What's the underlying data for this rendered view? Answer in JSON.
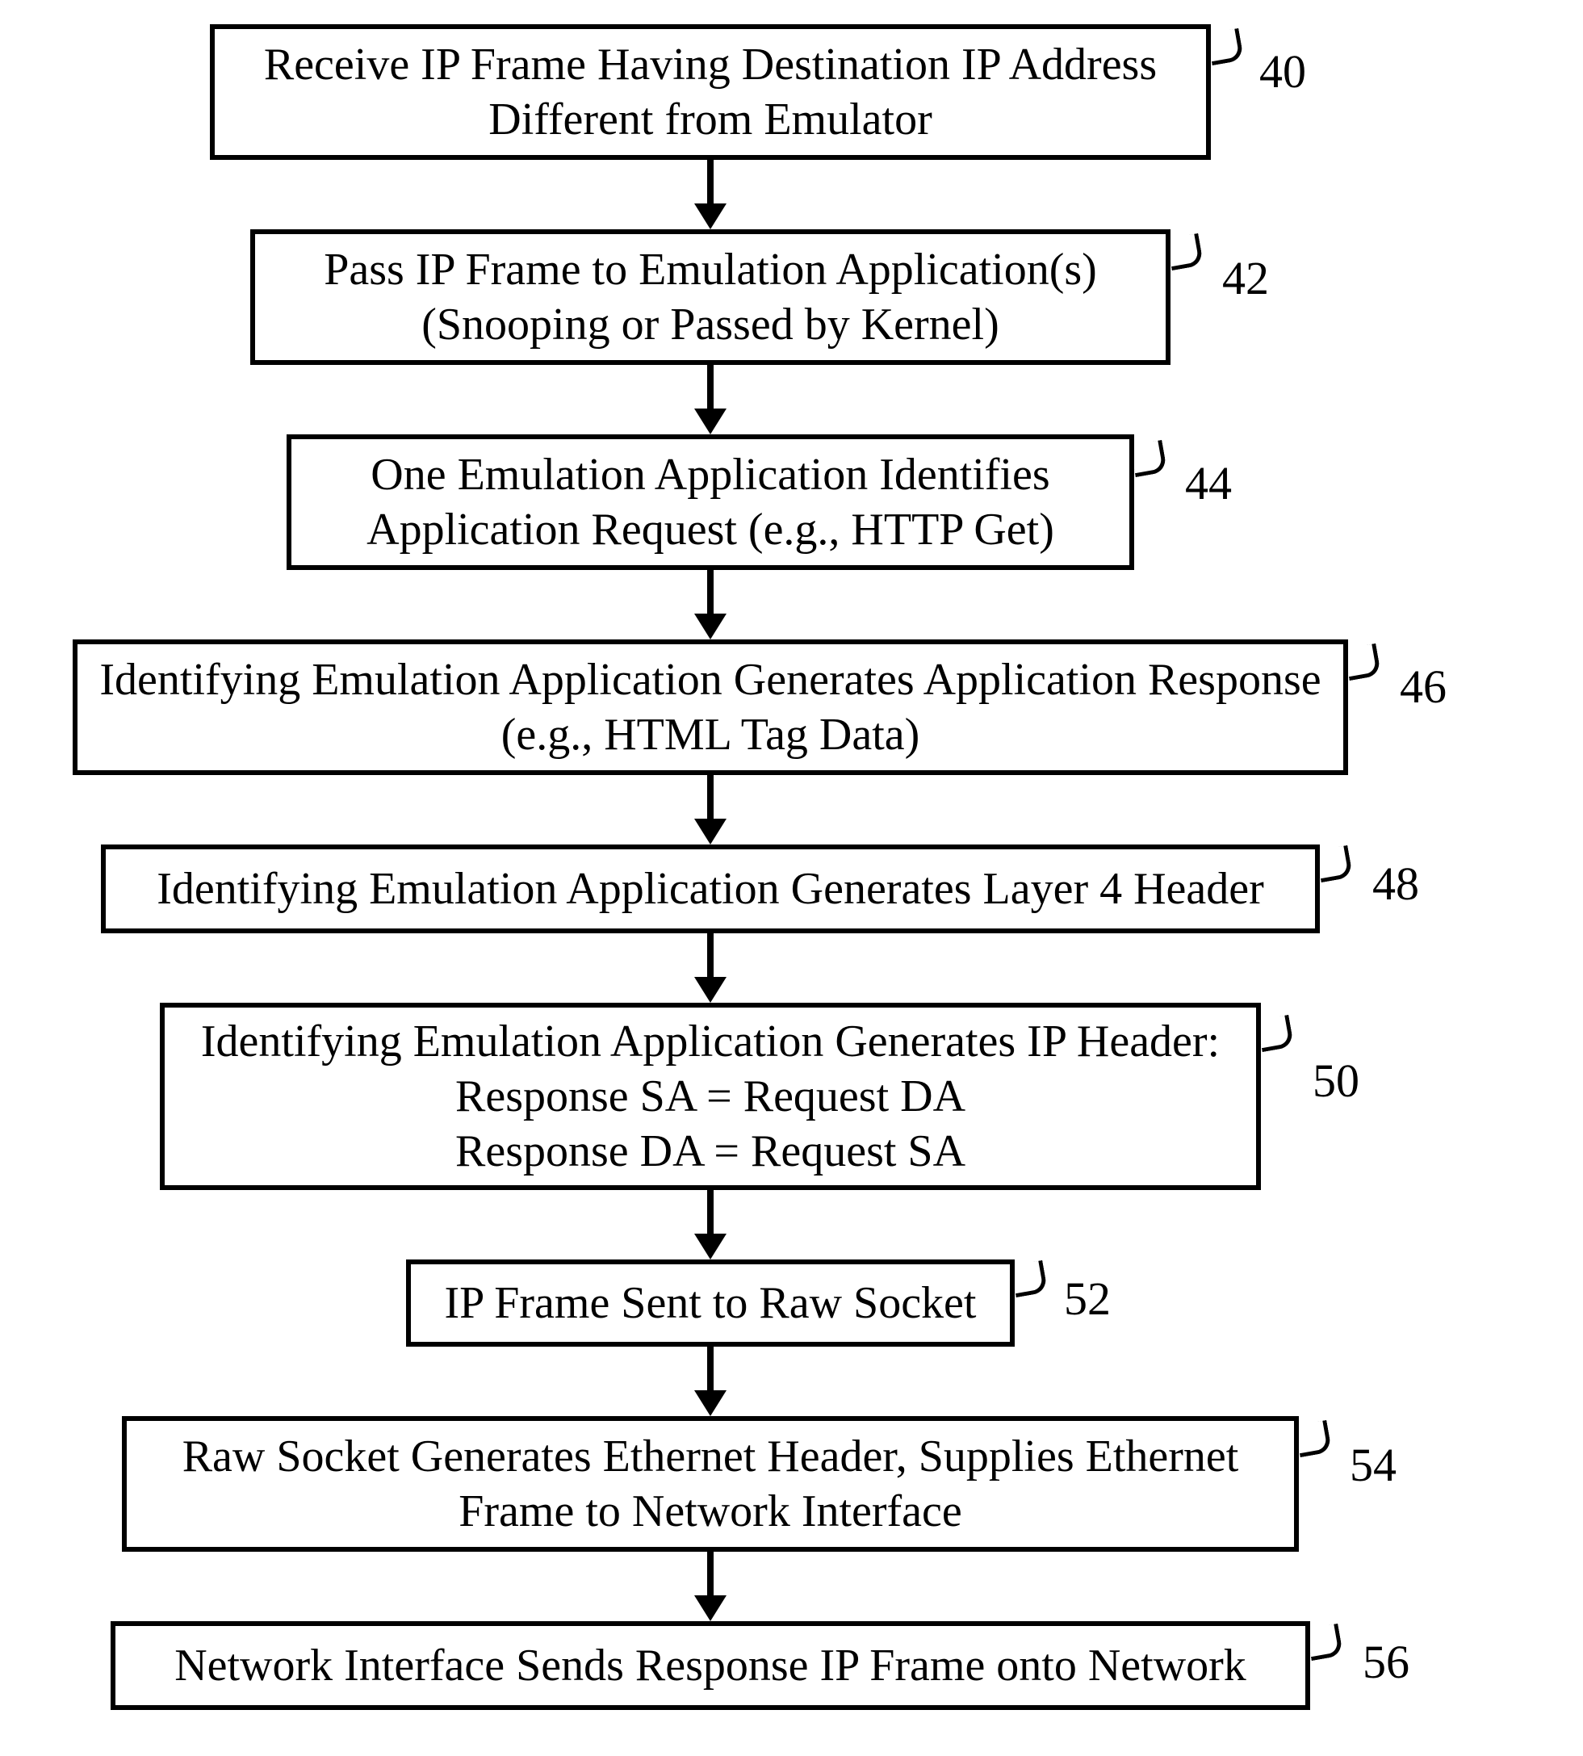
{
  "chart_data": {
    "type": "flowchart",
    "direction": "top-to-bottom",
    "nodes": [
      {
        "id": "40",
        "label": "Receive IP Frame Having Destination IP Address Different from Emulator"
      },
      {
        "id": "42",
        "label": "Pass IP Frame to Emulation Application(s) (Snooping or Passed by Kernel)"
      },
      {
        "id": "44",
        "label": "One Emulation Application Identifies Application Request (e.g., HTTP Get)"
      },
      {
        "id": "46",
        "label": "Identifying Emulation Application Generates Application Response (e.g., HTML Tag Data)"
      },
      {
        "id": "48",
        "label": "Identifying Emulation Application Generates Layer 4 Header"
      },
      {
        "id": "50",
        "label": "Identifying Emulation Application Generates IP Header:\nResponse SA = Request DA\nResponse DA = Request SA"
      },
      {
        "id": "52",
        "label": "IP Frame Sent to Raw Socket"
      },
      {
        "id": "54",
        "label": "Raw Socket Generates Ethernet Header, Supplies Ethernet Frame to Network Interface"
      },
      {
        "id": "56",
        "label": "Network Interface Sends Response IP Frame onto Network"
      }
    ],
    "edges": [
      {
        "from": "40",
        "to": "42"
      },
      {
        "from": "42",
        "to": "44"
      },
      {
        "from": "44",
        "to": "46"
      },
      {
        "from": "46",
        "to": "48"
      },
      {
        "from": "48",
        "to": "50"
      },
      {
        "from": "50",
        "to": "52"
      },
      {
        "from": "52",
        "to": "54"
      },
      {
        "from": "54",
        "to": "56"
      }
    ]
  },
  "steps": {
    "s40": {
      "num": "40",
      "text": "Receive IP Frame Having Destination IP Address\nDifferent from Emulator"
    },
    "s42": {
      "num": "42",
      "text": "Pass IP Frame to Emulation Application(s)\n(Snooping or Passed by Kernel)"
    },
    "s44": {
      "num": "44",
      "text": "One Emulation Application Identifies\nApplication Request (e.g., HTTP Get)"
    },
    "s46": {
      "num": "46",
      "text": "Identifying Emulation Application Generates Application Response\n(e.g., HTML Tag Data)"
    },
    "s48": {
      "num": "48",
      "text": "Identifying Emulation Application Generates Layer 4 Header"
    },
    "s50": {
      "num": "50",
      "text": "Identifying Emulation Application Generates IP Header:\nResponse SA = Request DA\nResponse DA = Request SA"
    },
    "s52": {
      "num": "52",
      "text": "IP Frame Sent to Raw Socket"
    },
    "s54": {
      "num": "54",
      "text": "Raw Socket Generates Ethernet Header, Supplies Ethernet\nFrame to Network Interface"
    },
    "s56": {
      "num": "56",
      "text": "Network Interface Sends Response IP Frame onto Network"
    }
  }
}
